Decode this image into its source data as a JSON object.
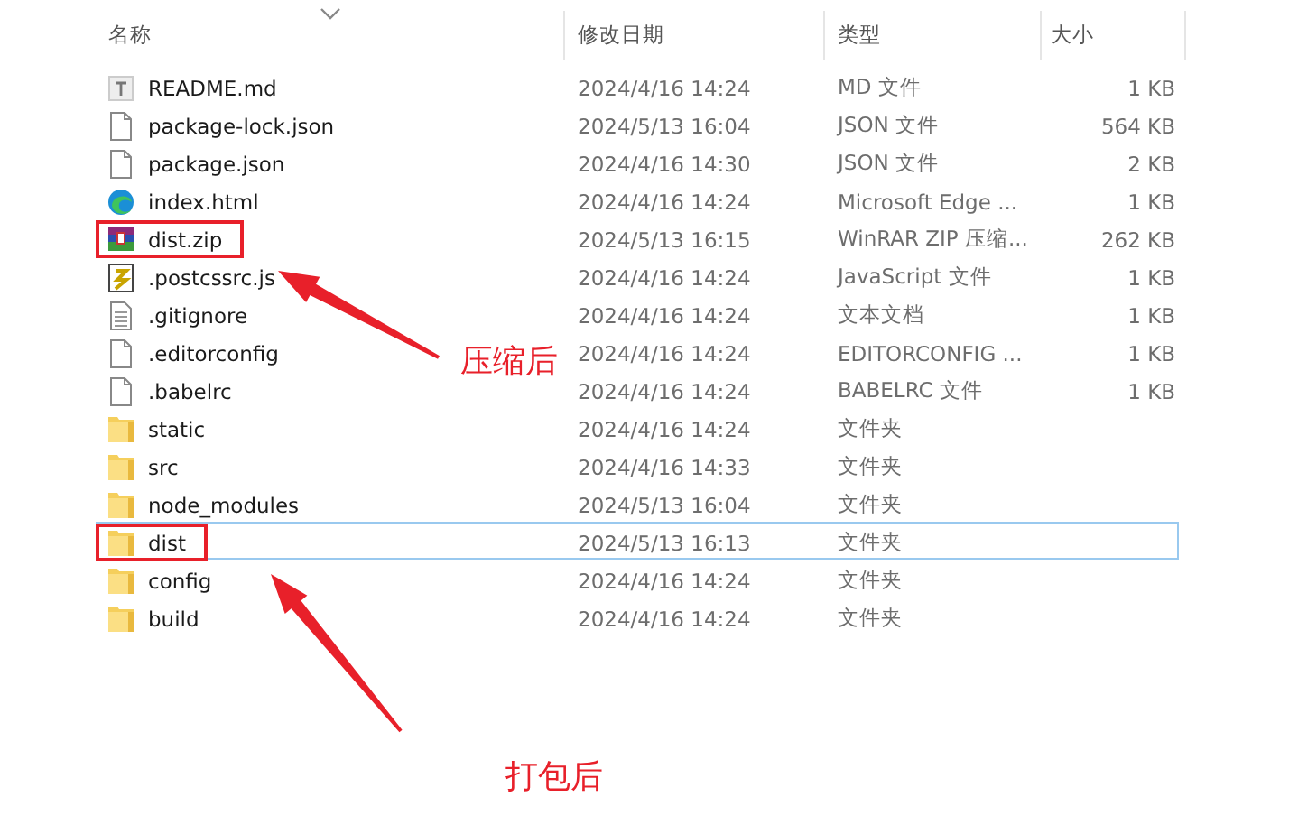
{
  "columns": [
    "名称",
    "修改日期",
    "类型",
    "大小"
  ],
  "rows": [
    {
      "name": "README.md",
      "date": "2024/4/16 14:24",
      "type": "MD 文件",
      "size": "1 KB",
      "kind": "doc",
      "focused": false,
      "highlighted": false
    },
    {
      "name": "package-lock.json",
      "date": "2024/5/13 16:04",
      "type": "JSON 文件",
      "size": "564 KB",
      "kind": "file",
      "focused": false,
      "highlighted": false
    },
    {
      "name": "package.json",
      "date": "2024/4/16 14:30",
      "type": "JSON 文件",
      "size": "2 KB",
      "kind": "file",
      "focused": false,
      "highlighted": false
    },
    {
      "name": "index.html",
      "date": "2024/4/16 14:24",
      "type": "Microsoft Edge ...",
      "size": "1 KB",
      "kind": "edge",
      "focused": false,
      "highlighted": false
    },
    {
      "name": "dist.zip",
      "date": "2024/5/13 16:15",
      "type": "WinRAR ZIP 压缩...",
      "size": "262 KB",
      "kind": "archive",
      "focused": false,
      "highlighted": true
    },
    {
      "name": ".postcssrc.js",
      "date": "2024/4/16 14:24",
      "type": "JavaScript 文件",
      "size": "1 KB",
      "kind": "script",
      "focused": false,
      "highlighted": false
    },
    {
      "name": ".gitignore",
      "date": "2024/4/16 14:24",
      "type": "文本文档",
      "size": "1 KB",
      "kind": "text",
      "focused": false,
      "highlighted": false
    },
    {
      "name": ".editorconfig",
      "date": "2024/4/16 14:24",
      "type": "EDITORCONFIG ...",
      "size": "1 KB",
      "kind": "file",
      "focused": false,
      "highlighted": false
    },
    {
      "name": ".babelrc",
      "date": "2024/4/16 14:24",
      "type": "BABELRC 文件",
      "size": "1 KB",
      "kind": "file",
      "focused": false,
      "highlighted": false
    },
    {
      "name": "static",
      "date": "2024/4/16 14:24",
      "type": "文件夹",
      "kind": "folder",
      "focused": false,
      "highlighted": false
    },
    {
      "name": "src",
      "date": "2024/4/16 14:33",
      "type": "文件夹",
      "kind": "folder",
      "focused": false,
      "highlighted": false
    },
    {
      "name": "node_modules",
      "date": "2024/5/13 16:04",
      "type": "文件夹",
      "kind": "folder",
      "focused": false,
      "highlighted": false
    },
    {
      "name": "dist",
      "date": "2024/5/13 16:13",
      "type": "文件夹",
      "kind": "folder",
      "focused": true,
      "highlighted": true
    },
    {
      "name": "config",
      "date": "2024/4/16 14:24",
      "type": "文件夹",
      "kind": "folder",
      "focused": false,
      "highlighted": false
    },
    {
      "name": "build",
      "date": "2024/4/16 14:24",
      "type": "文件夹",
      "kind": "folder",
      "focused": false,
      "highlighted": false
    }
  ],
  "annotations": [
    {
      "label": "压缩后"
    },
    {
      "label": "打包后"
    }
  ]
}
